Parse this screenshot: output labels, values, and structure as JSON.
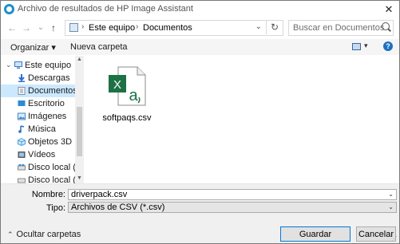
{
  "window": {
    "title": "Archivo de resultados de HP Image Assistant",
    "close_glyph": "✕"
  },
  "nav": {
    "back_glyph": "←",
    "forward_glyph": "→",
    "recent_glyph": "⌄",
    "up_glyph": "↑",
    "breadcrumbs": [
      "Este equipo",
      "Documentos"
    ],
    "crumb_separator": "›",
    "refresh_glyph": "↻",
    "search_placeholder": "Buscar en Documentos"
  },
  "toolbar": {
    "organize_label": "Organizar ▾",
    "new_folder_label": "Nueva carpeta",
    "help_glyph": "?"
  },
  "sidebar": {
    "items": [
      {
        "label": "Este equipo",
        "icon": "computer-icon",
        "color": "#3a7bd5",
        "selected": false
      },
      {
        "label": "Descargas",
        "icon": "downloads-icon",
        "color": "#2f6fd0",
        "selected": false
      },
      {
        "label": "Documentos",
        "icon": "documents-icon",
        "color": "#7f8ea3",
        "selected": true
      },
      {
        "label": "Escritorio",
        "icon": "desktop-icon",
        "color": "#2b8ad9",
        "selected": false
      },
      {
        "label": "Imágenes",
        "icon": "pictures-icon",
        "color": "#3d86c6",
        "selected": false
      },
      {
        "label": "Música",
        "icon": "music-icon",
        "color": "#2a6fb8",
        "selected": false
      },
      {
        "label": "Objetos 3D",
        "icon": "3d-objects-icon",
        "color": "#4aa3df",
        "selected": false
      },
      {
        "label": "Vídeos",
        "icon": "videos-icon",
        "color": "#5a5a5a",
        "selected": false
      },
      {
        "label": "Disco local (C:)",
        "icon": "drive-icon",
        "color": "#8a8a8a",
        "selected": false
      },
      {
        "label": "Disco local (D:)",
        "icon": "drive-icon",
        "color": "#8a8a8a",
        "selected": false
      }
    ]
  },
  "content": {
    "files": [
      {
        "name": "softpaqs.csv",
        "icon": "excel-csv-icon",
        "brand_color": "#1e7145"
      }
    ]
  },
  "form": {
    "name_label": "Nombre:",
    "name_value": "driverpack.csv",
    "type_label": "Tipo:",
    "type_value": "Archivos de CSV (*.csv)",
    "hide_folders_label": "Ocultar carpetas",
    "save_label": "Guardar",
    "cancel_label": "Cancelar"
  },
  "colors": {
    "accent": "#0078d7",
    "selection": "#cce8ff"
  }
}
